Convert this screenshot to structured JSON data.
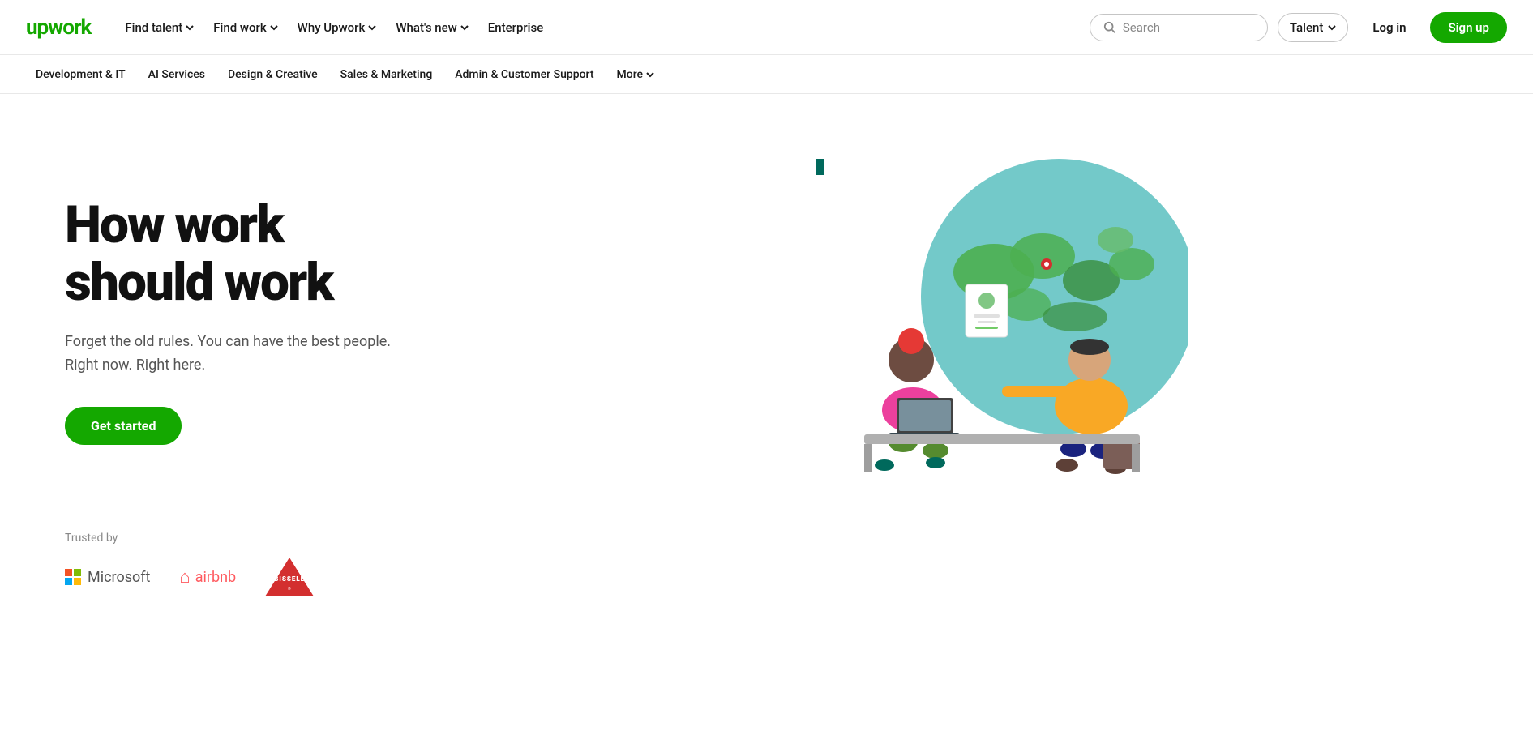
{
  "brand": {
    "logo_text": "upwork"
  },
  "navbar": {
    "links": [
      {
        "label": "Find talent",
        "has_dropdown": true
      },
      {
        "label": "Find work",
        "has_dropdown": true
      },
      {
        "label": "Why Upwork",
        "has_dropdown": true
      },
      {
        "label": "What's new",
        "has_dropdown": true
      },
      {
        "label": "Enterprise",
        "has_dropdown": false
      }
    ],
    "search_placeholder": "Search",
    "search_dropdown_label": "Talent",
    "login_label": "Log in",
    "signup_label": "Sign up"
  },
  "subnav": {
    "links": [
      {
        "label": "Development & IT"
      },
      {
        "label": "AI Services"
      },
      {
        "label": "Design & Creative"
      },
      {
        "label": "Sales & Marketing"
      },
      {
        "label": "Admin & Customer Support"
      }
    ],
    "more_label": "More"
  },
  "hero": {
    "title_line1": "How work",
    "title_line2": "should work",
    "subtitle_line1": "Forget the old rules. You can have the best people.",
    "subtitle_line2": "Right now. Right here.",
    "cta_label": "Get started"
  },
  "trusted": {
    "label": "Trusted by",
    "logos": [
      {
        "name": "Microsoft"
      },
      {
        "name": "airbnb"
      },
      {
        "name": "BISSELL"
      }
    ]
  }
}
